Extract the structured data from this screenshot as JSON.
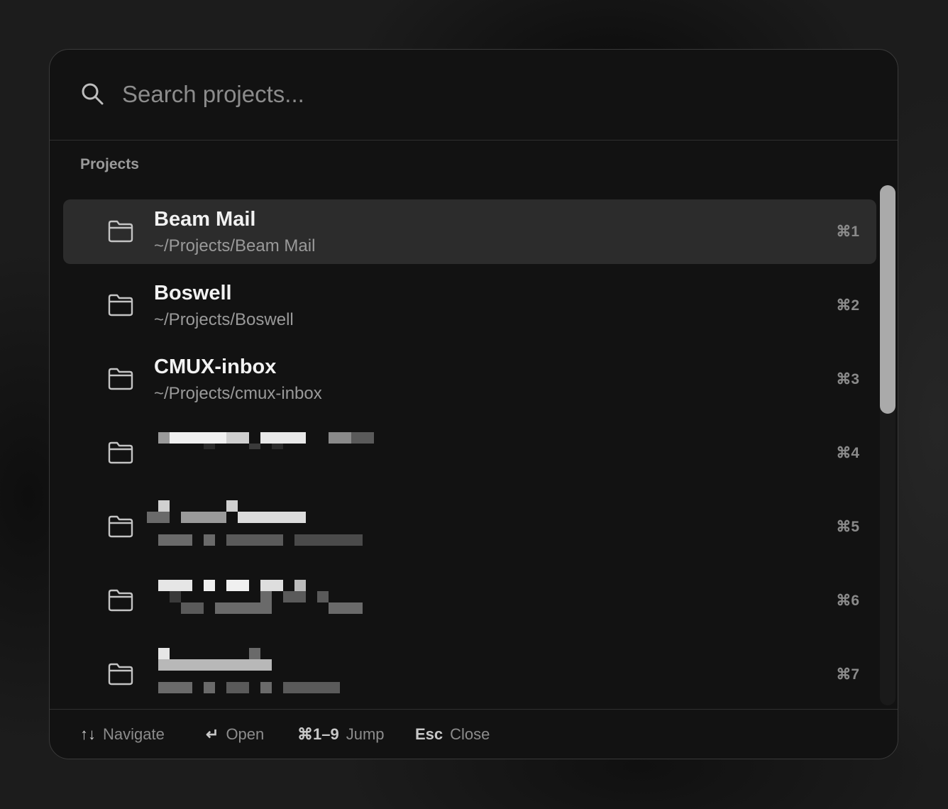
{
  "search": {
    "placeholder": "Search projects..."
  },
  "section_title": "Projects",
  "projects": [
    {
      "name": "Beam Mail",
      "path": "~/Projects/Beam Mail",
      "shortcut": "⌘1",
      "selected": true
    },
    {
      "name": "Boswell",
      "path": "~/Projects/Boswell",
      "shortcut": "⌘2"
    },
    {
      "name": "CMUX-inbox",
      "path": "~/Projects/cmux-inbox",
      "shortcut": "⌘3"
    },
    {
      "name": "",
      "path": "",
      "shortcut": "⌘4"
    },
    {
      "name": "",
      "path": "",
      "shortcut": "⌘5"
    },
    {
      "name": "",
      "path": "",
      "shortcut": "⌘6"
    },
    {
      "name": "",
      "path": "",
      "shortcut": "⌘7"
    }
  ],
  "footer": {
    "navigate": {
      "key": "↑↓",
      "label": "Navigate"
    },
    "open": {
      "key": "↵",
      "label": "Open"
    },
    "jump": {
      "key": "⌘1–9",
      "label": "Jump"
    },
    "close": {
      "key": "Esc",
      "label": "Close"
    }
  },
  "colors": {
    "panel_background": "#121212",
    "selected_row": "#2c2c2c",
    "primary_text": "#f2f2f2",
    "secondary_text": "#9a9a9a"
  },
  "icons": {
    "search": "search-icon",
    "folder": "folder-icon"
  }
}
